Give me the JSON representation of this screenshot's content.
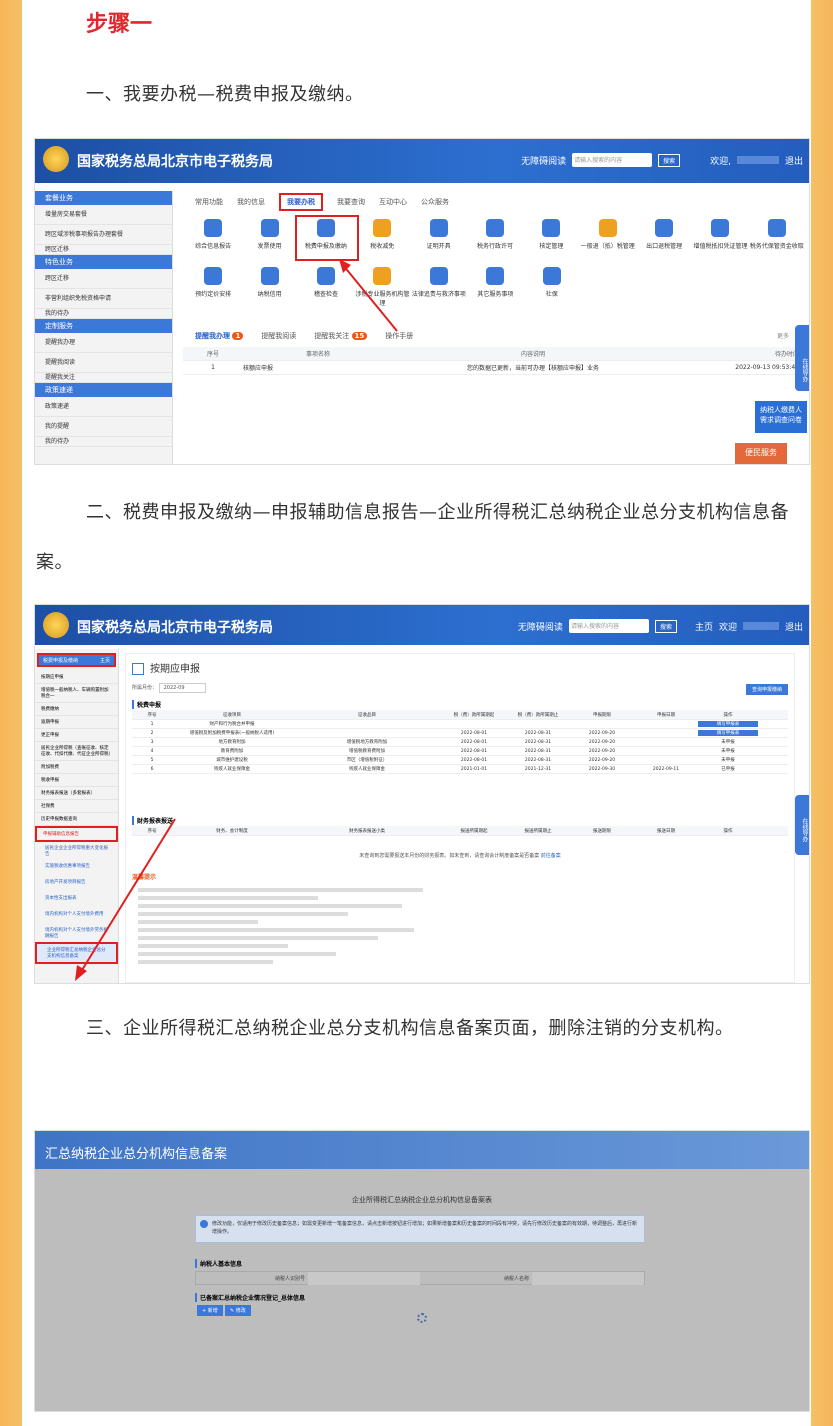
{
  "step_title": "步骤一",
  "para1": "一、我要办税—税费申报及缴纳。",
  "para2": "二、税费申报及缴纳—申报辅助信息报告—企业所得税汇总纳税企业总分支机构信息备案。",
  "para3": "三、企业所得税汇总纳税企业总分支机构信息备案页面，删除注销的分支机构。",
  "shot1": {
    "site_title": "国家税务总局北京市电子税务局",
    "header_links": [
      "无障碍阅读",
      "请输入搜索的内容",
      "搜索",
      "欢迎,",
      "退出"
    ],
    "sidebar": [
      {
        "head": "套餐业务",
        "items": [
          "增量房交易套餐",
          "跨区域涉税事项报告办理套餐",
          "跨区迁移"
        ]
      },
      {
        "head": "特色业务",
        "items": [
          "跨区迁移",
          "非营利组织免税资格申请",
          "我的待办"
        ]
      },
      {
        "head": "定制服务",
        "items": [
          "提醒我办理",
          "提醒我阅读",
          "提醒我关注"
        ]
      },
      {
        "head": "政策速递",
        "items": [
          "政策速递",
          "我的提醒",
          "我的待办"
        ]
      }
    ],
    "tabs": [
      "常用功能",
      "我的信息",
      "我要办税",
      "我要查询",
      "互动中心",
      "公众服务"
    ],
    "active_tab": "我要办税",
    "icons_row1": [
      "综合信息报告",
      "发票使用",
      "税费申报及缴纳",
      "税收减免",
      "证明开具",
      "税务行政许可",
      "核定管理",
      "一般退（抵）税管理",
      "出口退税管理",
      "增值税抵扣凭证管理",
      "税务代保管资金收取"
    ],
    "icons_row2": [
      "预约定价安排",
      "纳税信用",
      "稽查检查",
      "涉税专业服务机构管理",
      "法律追责与救济事项",
      "其它服务事项",
      "社保"
    ],
    "lower_tabs": [
      "提醒我办理",
      "提醒我阅读",
      "提醒我关注",
      "操作手册"
    ],
    "lower_badges": [
      "1",
      "15"
    ],
    "table_headers": [
      "序号",
      "事项名称",
      "内容说明",
      "待办时间"
    ],
    "table_rows": [
      [
        "1",
        "核额应申报",
        "您的数据已更新，当前可办理【核额应申报】业务",
        "2022-09-13 09:53:49"
      ]
    ],
    "float_text": "在线导办",
    "banner1": "纳税人缴费人需求调查问卷",
    "banner2": "便民服务",
    "more": "更多"
  },
  "shot2": {
    "site_title": "国家税务总局北京市电子税务局",
    "header_links": [
      "无障碍阅读",
      "请输入搜索的内容",
      "搜索",
      "主页",
      "欢迎",
      "退出"
    ],
    "sidebar_top": "税费申报及缴纳",
    "sidebar_top_btn": "主页",
    "sidebar_items": [
      "按期应申报",
      "增值税一般纳税人、车辆购置附加税合一",
      "税费缴纳",
      "逾期申报",
      "更正申报",
      "居民企业所得税（查账征收、核定征收、代扣代缴、代征企业所得税）",
      "附加税费",
      "税收申报",
      "财务报表报送（多套报表）",
      "社保费",
      "历史申报数据查询",
      "申报辅助信息报告"
    ],
    "sub_items": [
      "居民企业企业所得税重大变化报告",
      "实施税收优惠事项报告",
      "房地产开发项目报告",
      "资本性支出报表",
      "境内机构对个人支付境外费用",
      "境内机构对个人支付境外劳务报酬报告",
      "企业所得税汇总纳税企业总分支机构信息备案"
    ],
    "page_title": "按期应申报",
    "period_label": "所属月份：",
    "period_value": "2022-09",
    "query_btn": "查询申报缴纳",
    "sec1": "税费申报",
    "t1_headers": [
      "序号",
      "征收项目",
      "征收品目",
      "税（费）款所属期起",
      "税（费）款所属期止",
      "申报期限",
      "申报日期",
      "操作"
    ],
    "t1_rows": [
      [
        "1",
        "财产和行为税合并申报",
        "",
        "",
        "",
        "",
        "",
        "填写申报表"
      ],
      [
        "2",
        "增值税及附加税费申报表(一般纳税人适用)",
        "",
        "2022-08-01",
        "2022-08-31",
        "2022-09-20",
        "",
        "填写申报表"
      ],
      [
        "3",
        "地方教育附加",
        "增值税地方教育附加",
        "2022-08-01",
        "2022-08-31",
        "2022-09-20",
        "",
        "未申报"
      ],
      [
        "4",
        "教育费附加",
        "增值税教育费附加",
        "2022-08-01",
        "2022-08-31",
        "2022-09-20",
        "",
        "未申报"
      ],
      [
        "5",
        "城市维护建设税",
        "市区（增值税附征）",
        "2022-08-01",
        "2022-08-31",
        "2022-09-20",
        "",
        "未申报"
      ],
      [
        "6",
        "残疾人就业保障金",
        "残疾人就业保障金",
        "2021-01-01",
        "2021-12-31",
        "2022-09-30",
        "2022-09-11",
        "已申报"
      ]
    ],
    "sec2": "财务报表报送",
    "t2_headers": [
      "序号",
      "财务、会计制度",
      "财务报表报送小类",
      "报送所属期起",
      "报送所属期止",
      "报送期限",
      "报送日期",
      "操作"
    ],
    "t2_note": "未查询到您需要报送本月份的财务报表。如未查到，请查询会计制度备案是否备案",
    "t2_link": "前往备案",
    "tips_title": "温馨提示",
    "float_text": "在线导办"
  },
  "shot3": {
    "header": "汇总纳税企业总分机构信息备案",
    "doc_title": "企业所得税汇总纳税企业总分机构信息备案表",
    "notice": "修改功能，仅适用于修改历史备案信息；如需变更新增一笔备案信息，请点击新增按钮进行增加；如果新增备案和历史备案的时间段有冲突，请先行修改历史备案的有效期，待调整后，再进行新增操作。",
    "sec1": "纳税人基本信息",
    "field1": "纳税人识别号",
    "field2": "纳税人名称",
    "sec2": "已备案汇总纳税企业情况登记_总体信息",
    "btn_add": "+ 新增",
    "btn_edit": "✎ 修改"
  }
}
